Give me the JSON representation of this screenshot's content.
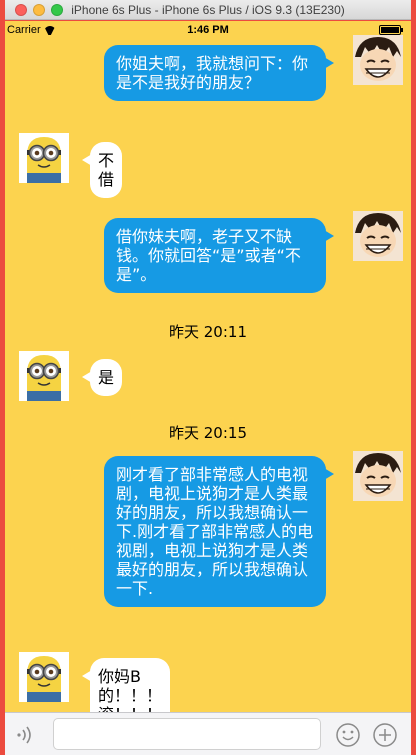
{
  "window": {
    "title": "iPhone 6s Plus - iPhone 6s Plus / iOS 9.3 (13E230)"
  },
  "status_bar": {
    "carrier": "Carrier",
    "time": "1:46 PM",
    "battery_level": 1.0
  },
  "messages": [
    {
      "side": "out",
      "text": "你姐夫啊，我就想问下：你是不是我好的朋友？"
    },
    {
      "side": "in",
      "text": "不借"
    },
    {
      "side": "out",
      "text": "借你妹夫啊，老子又不缺钱。你就回答“是”或者“不是”。"
    },
    {
      "time": "昨天 20:11"
    },
    {
      "side": "in",
      "text": "是"
    },
    {
      "time": "昨天 20:15"
    },
    {
      "side": "out",
      "text": "刚才看了部非常感人的电视剧，电视上说狗才是人类最好的朋友，所以我想确认一下.刚才看了部非常感人的电视剧，电视上说狗才是人类最好的朋友，所以我想确认一下."
    },
    {
      "side": "in",
      "text": "你妈B的！！！滚！！！"
    }
  ],
  "input_bar": {
    "text_value": "",
    "voice_icon": "voice-icon",
    "emoji_icon": "emoji-icon",
    "more_icon": "plus-icon"
  },
  "colors": {
    "chat_background": "#fcd34f",
    "outgoing_bubble": "#169ae4",
    "incoming_bubble": "#ffffff"
  }
}
